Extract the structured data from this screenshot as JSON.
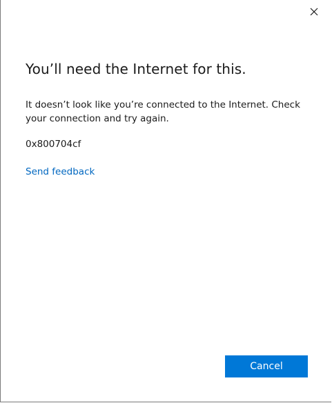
{
  "dialog": {
    "close_icon": "close-icon",
    "title": "You’ll need the Internet for this.",
    "message": "It doesn’t look like you’re connected to the Internet. Check your connection and try again.",
    "error_code": "0x800704cf",
    "feedback_link": "Send feedback",
    "cancel_label": "Cancel"
  },
  "colors": {
    "accent": "#0078d7",
    "link": "#0067c0",
    "text": "#1a1a1a",
    "background": "#ffffff"
  }
}
